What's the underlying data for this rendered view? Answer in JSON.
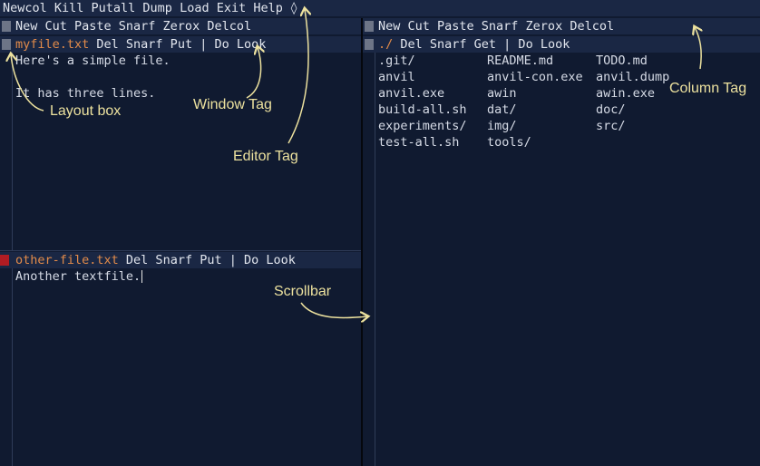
{
  "editor_tag": "Newcol Kill Putall Dump Load Exit Help ◊",
  "left_column": {
    "column_tag": "New Cut Paste Snarf Zerox Delcol",
    "windows": [
      {
        "filename": "myfile.txt",
        "tag_rest": " Del Snarf Put | Do Look",
        "lines": [
          "Here's a simple file.",
          "",
          "It has three lines."
        ]
      },
      {
        "filename": "other-file.txt",
        "tag_rest": " Del Snarf Put | Do Look",
        "lines": [
          "Another textfile."
        ]
      }
    ]
  },
  "right_column": {
    "column_tag": "New Cut Paste Snarf Zerox Delcol",
    "window": {
      "filename": "./",
      "tag_rest": " Del Snarf Get | Do Look",
      "entries": [
        ".git/",
        "README.md",
        "TODO.md",
        "anvil",
        "anvil-con.exe",
        "anvil.dump",
        "anvil.exe",
        "awin",
        "awin.exe",
        "build-all.sh",
        "dat/",
        "doc/",
        "experiments/",
        "img/",
        "src/",
        "test-all.sh",
        "tools/"
      ]
    }
  },
  "annotations": {
    "layout_box": "Layout box",
    "window_tag": "Window Tag",
    "editor_tag": "Editor Tag",
    "column_tag": "Column Tag",
    "scrollbar": "Scrollbar"
  },
  "colors": {
    "background": "#101a30",
    "tag_bg": "#1a2744",
    "filename": "#e28b4a",
    "layout_box_gray": "#6d7587",
    "layout_box_red": "#b01c23",
    "annotation": "#ece19e"
  }
}
